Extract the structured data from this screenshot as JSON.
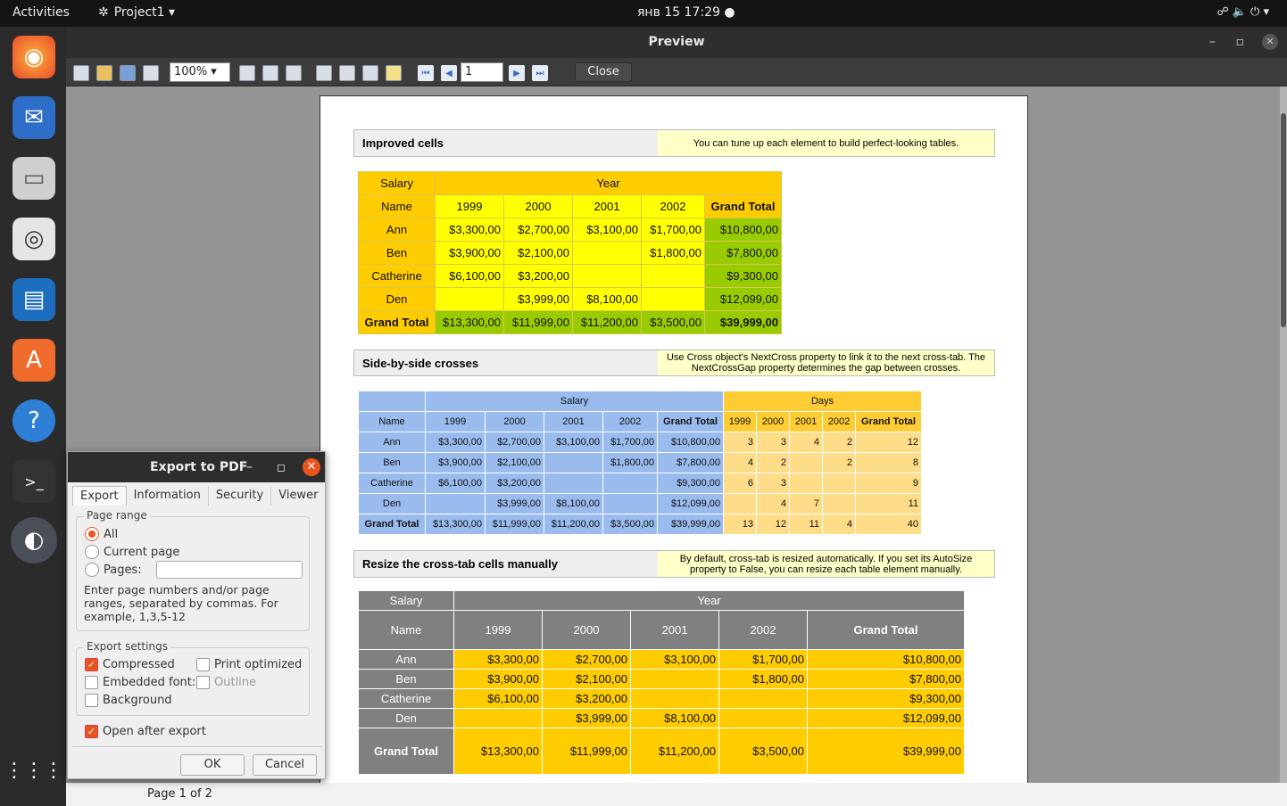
{
  "topbar": {
    "activities": "Activities",
    "app": "Project1 ▾",
    "clock": "янв 15  17:29  ●",
    "tray": "☍  🔈  ⏻ ▾"
  },
  "window": {
    "title": "Preview",
    "zoom": "100% ▾",
    "page": "1",
    "close": "Close",
    "status": "Page 1 of 2",
    "min": "–",
    "max": "▫",
    "x": "✕"
  },
  "sections": [
    {
      "title": "Improved cells",
      "note": "You can tune up each element to build perfect-looking tables."
    },
    {
      "title": "Side-by-side crosses",
      "note": "Use Cross object's NextCross property to link it to the next cross-tab. The NextCrossGap property determines the gap between crosses."
    },
    {
      "title": "Resize the cross-tab cells manually",
      "note": "By default, cross-tab is resized automatically. If you set its AutoSize property to False, you can resize each table element manually."
    }
  ],
  "t1": {
    "salary": "Salary",
    "year": "Year",
    "name": "Name",
    "years": [
      "1999",
      "2000",
      "2001",
      "2002"
    ],
    "gt": "Grand Total",
    "rows": [
      [
        "Ann",
        "$3,300,00",
        "$2,700,00",
        "$3,100,00",
        "$1,700,00",
        "$10,800,00"
      ],
      [
        "Ben",
        "$3,900,00",
        "$2,100,00",
        "",
        "$1,800,00",
        "$7,800,00"
      ],
      [
        "Catherine",
        "$6,100,00",
        "$3,200,00",
        "",
        "",
        "$9,300,00"
      ],
      [
        "Den",
        "",
        "$3,999,00",
        "$8,100,00",
        "",
        "$12,099,00"
      ],
      [
        "Grand Total",
        "$13,300,00",
        "$11,999,00",
        "$11,200,00",
        "$3,500,00",
        "$39,999,00"
      ]
    ]
  },
  "t2": {
    "salary": "Salary",
    "days": "Days",
    "name": "Name",
    "years": [
      "1999",
      "2000",
      "2001",
      "2002"
    ],
    "gt": "Grand Total",
    "rows": [
      [
        "Ann",
        "$3,300,00",
        "$2,700,00",
        "$3,100,00",
        "$1,700,00",
        "$10,800,00",
        "3",
        "3",
        "4",
        "2",
        "12"
      ],
      [
        "Ben",
        "$3,900,00",
        "$2,100,00",
        "",
        "$1,800,00",
        "$7,800,00",
        "4",
        "2",
        "",
        "2",
        "8"
      ],
      [
        "Catherine",
        "$6,100,00",
        "$3,200,00",
        "",
        "",
        "$9,300,00",
        "6",
        "3",
        "",
        "",
        "9"
      ],
      [
        "Den",
        "",
        "$3,999,00",
        "$8,100,00",
        "",
        "$12,099,00",
        "",
        "4",
        "7",
        "",
        "11"
      ],
      [
        "Grand Total",
        "$13,300,00",
        "$11,999,00",
        "$11,200,00",
        "$3,500,00",
        "$39,999,00",
        "13",
        "12",
        "11",
        "4",
        "40"
      ]
    ]
  },
  "dialog": {
    "title": "Export to PDF",
    "min": "–",
    "max": "◻",
    "x": "✕",
    "tabs": [
      "Export",
      "Information",
      "Security",
      "Viewer"
    ],
    "page_range": "Page range",
    "all": "All",
    "current": "Current page",
    "pages": "Pages:",
    "hint": "Enter page numbers and/or page ranges, separated by commas. For example, 1,3,5-12",
    "export_settings": "Export settings",
    "compressed": "Compressed",
    "print_optimized": "Print optimized",
    "embedded": "Embedded font:",
    "outline": "Outline",
    "background": "Background",
    "open_after": "Open after export",
    "ok": "OK",
    "cancel": "Cancel"
  },
  "colors": {
    "orange": "#ffcc00",
    "yellow": "#ffff00",
    "green": "#99cc00",
    "blue": "#99bbee",
    "gray": "#808080",
    "accent": "#e95420"
  }
}
